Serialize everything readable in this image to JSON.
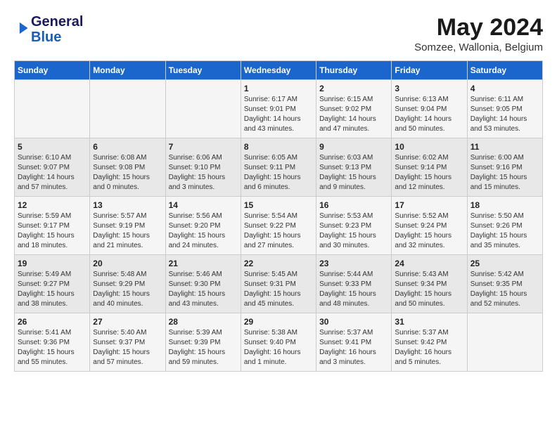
{
  "header": {
    "logo_line1": "General",
    "logo_line2": "Blue",
    "main_title": "May 2024",
    "subtitle": "Somzee, Wallonia, Belgium"
  },
  "days_of_week": [
    "Sunday",
    "Monday",
    "Tuesday",
    "Wednesday",
    "Thursday",
    "Friday",
    "Saturday"
  ],
  "weeks": [
    [
      {
        "day": "",
        "info": ""
      },
      {
        "day": "",
        "info": ""
      },
      {
        "day": "",
        "info": ""
      },
      {
        "day": "1",
        "info": "Sunrise: 6:17 AM\nSunset: 9:01 PM\nDaylight: 14 hours\nand 43 minutes."
      },
      {
        "day": "2",
        "info": "Sunrise: 6:15 AM\nSunset: 9:02 PM\nDaylight: 14 hours\nand 47 minutes."
      },
      {
        "day": "3",
        "info": "Sunrise: 6:13 AM\nSunset: 9:04 PM\nDaylight: 14 hours\nand 50 minutes."
      },
      {
        "day": "4",
        "info": "Sunrise: 6:11 AM\nSunset: 9:05 PM\nDaylight: 14 hours\nand 53 minutes."
      }
    ],
    [
      {
        "day": "5",
        "info": "Sunrise: 6:10 AM\nSunset: 9:07 PM\nDaylight: 14 hours\nand 57 minutes."
      },
      {
        "day": "6",
        "info": "Sunrise: 6:08 AM\nSunset: 9:08 PM\nDaylight: 15 hours\nand 0 minutes."
      },
      {
        "day": "7",
        "info": "Sunrise: 6:06 AM\nSunset: 9:10 PM\nDaylight: 15 hours\nand 3 minutes."
      },
      {
        "day": "8",
        "info": "Sunrise: 6:05 AM\nSunset: 9:11 PM\nDaylight: 15 hours\nand 6 minutes."
      },
      {
        "day": "9",
        "info": "Sunrise: 6:03 AM\nSunset: 9:13 PM\nDaylight: 15 hours\nand 9 minutes."
      },
      {
        "day": "10",
        "info": "Sunrise: 6:02 AM\nSunset: 9:14 PM\nDaylight: 15 hours\nand 12 minutes."
      },
      {
        "day": "11",
        "info": "Sunrise: 6:00 AM\nSunset: 9:16 PM\nDaylight: 15 hours\nand 15 minutes."
      }
    ],
    [
      {
        "day": "12",
        "info": "Sunrise: 5:59 AM\nSunset: 9:17 PM\nDaylight: 15 hours\nand 18 minutes."
      },
      {
        "day": "13",
        "info": "Sunrise: 5:57 AM\nSunset: 9:19 PM\nDaylight: 15 hours\nand 21 minutes."
      },
      {
        "day": "14",
        "info": "Sunrise: 5:56 AM\nSunset: 9:20 PM\nDaylight: 15 hours\nand 24 minutes."
      },
      {
        "day": "15",
        "info": "Sunrise: 5:54 AM\nSunset: 9:22 PM\nDaylight: 15 hours\nand 27 minutes."
      },
      {
        "day": "16",
        "info": "Sunrise: 5:53 AM\nSunset: 9:23 PM\nDaylight: 15 hours\nand 30 minutes."
      },
      {
        "day": "17",
        "info": "Sunrise: 5:52 AM\nSunset: 9:24 PM\nDaylight: 15 hours\nand 32 minutes."
      },
      {
        "day": "18",
        "info": "Sunrise: 5:50 AM\nSunset: 9:26 PM\nDaylight: 15 hours\nand 35 minutes."
      }
    ],
    [
      {
        "day": "19",
        "info": "Sunrise: 5:49 AM\nSunset: 9:27 PM\nDaylight: 15 hours\nand 38 minutes."
      },
      {
        "day": "20",
        "info": "Sunrise: 5:48 AM\nSunset: 9:29 PM\nDaylight: 15 hours\nand 40 minutes."
      },
      {
        "day": "21",
        "info": "Sunrise: 5:46 AM\nSunset: 9:30 PM\nDaylight: 15 hours\nand 43 minutes."
      },
      {
        "day": "22",
        "info": "Sunrise: 5:45 AM\nSunset: 9:31 PM\nDaylight: 15 hours\nand 45 minutes."
      },
      {
        "day": "23",
        "info": "Sunrise: 5:44 AM\nSunset: 9:33 PM\nDaylight: 15 hours\nand 48 minutes."
      },
      {
        "day": "24",
        "info": "Sunrise: 5:43 AM\nSunset: 9:34 PM\nDaylight: 15 hours\nand 50 minutes."
      },
      {
        "day": "25",
        "info": "Sunrise: 5:42 AM\nSunset: 9:35 PM\nDaylight: 15 hours\nand 52 minutes."
      }
    ],
    [
      {
        "day": "26",
        "info": "Sunrise: 5:41 AM\nSunset: 9:36 PM\nDaylight: 15 hours\nand 55 minutes."
      },
      {
        "day": "27",
        "info": "Sunrise: 5:40 AM\nSunset: 9:37 PM\nDaylight: 15 hours\nand 57 minutes."
      },
      {
        "day": "28",
        "info": "Sunrise: 5:39 AM\nSunset: 9:39 PM\nDaylight: 15 hours\nand 59 minutes."
      },
      {
        "day": "29",
        "info": "Sunrise: 5:38 AM\nSunset: 9:40 PM\nDaylight: 16 hours\nand 1 minute."
      },
      {
        "day": "30",
        "info": "Sunrise: 5:37 AM\nSunset: 9:41 PM\nDaylight: 16 hours\nand 3 minutes."
      },
      {
        "day": "31",
        "info": "Sunrise: 5:37 AM\nSunset: 9:42 PM\nDaylight: 16 hours\nand 5 minutes."
      },
      {
        "day": "",
        "info": ""
      }
    ]
  ]
}
